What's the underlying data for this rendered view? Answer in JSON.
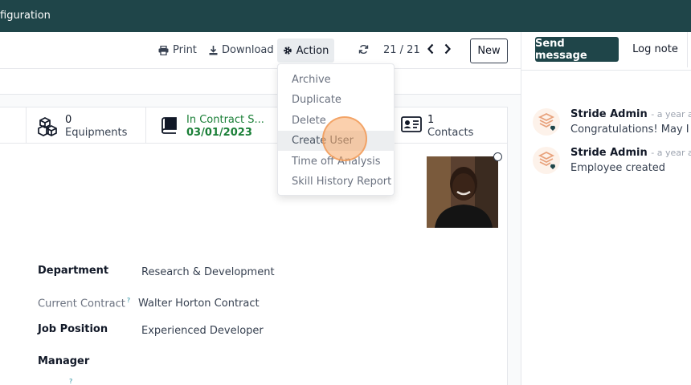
{
  "topbar": {
    "menu_label": "figuration"
  },
  "toolbar": {
    "print_label": "Print",
    "download_label": "Download",
    "action_label": "Action",
    "pager": "21 / 21",
    "new_label": "New"
  },
  "action_menu": {
    "items": [
      "Archive",
      "Duplicate",
      "Delete",
      "Create User",
      "Time off Analysis",
      "Skill History Report"
    ],
    "highlighted": "Create User"
  },
  "smart_buttons": {
    "equipments": {
      "value": "0",
      "label": "Equipments"
    },
    "contract": {
      "value": "In Contract S...",
      "label": "03/01/2023"
    },
    "contacts": {
      "value": "1",
      "label": "Contacts"
    }
  },
  "form": {
    "department_label": "Department",
    "department_value": "Research & Development",
    "current_contract_label": "Current Contract",
    "current_contract_help": "?",
    "current_contract_value": "Walter Horton Contract",
    "job_position_label": "Job Position",
    "job_position_value": "Experienced Developer",
    "manager_label": "Manager",
    "next_help": "?"
  },
  "chatter": {
    "send_message_label": "Send message",
    "log_note_label": "Log note",
    "messages": [
      {
        "author": "Stride Admin",
        "date": "- a year ago",
        "body": "Congratulations! May I rec"
      },
      {
        "author": "Stride Admin",
        "date": "- a year ago",
        "body": "Employee created"
      }
    ]
  },
  "colors": {
    "brand": "#1f4549",
    "green_status": "#1a7f37",
    "click_marker": "#f7aa69"
  },
  "icons": [
    "print-icon",
    "download-icon",
    "gear-icon",
    "refresh-icon",
    "chevron-left-icon",
    "chevron-right-icon",
    "cubes-icon",
    "book-icon",
    "contact-card-icon"
  ]
}
